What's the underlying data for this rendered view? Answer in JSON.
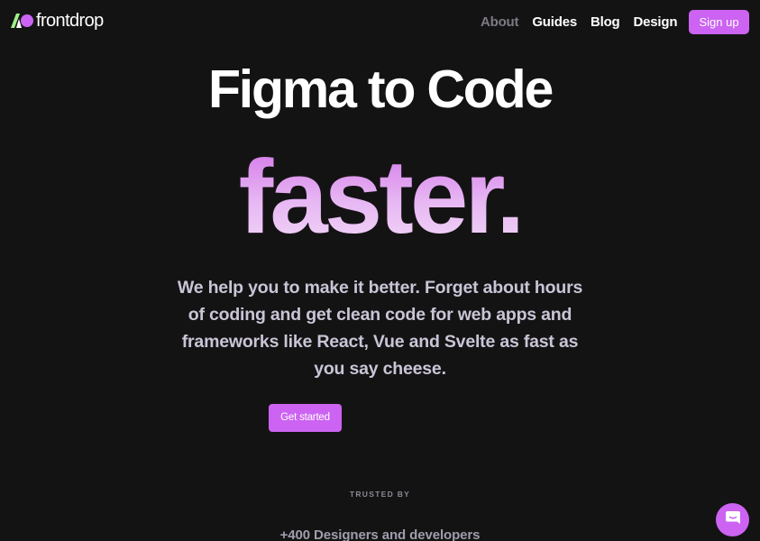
{
  "brand": {
    "name": "frontdrop",
    "accent_color": "#cc63f2",
    "logo_icon": "frontdrop-logo-icon"
  },
  "nav": {
    "items": [
      {
        "label": "About",
        "state": "active"
      },
      {
        "label": "Guides"
      },
      {
        "label": "Blog"
      },
      {
        "label": "Design"
      }
    ],
    "signup_label": "Sign up"
  },
  "hero": {
    "headline": "Figma to Code",
    "accent_word": "faster.",
    "description": "We help you to make it better. Forget about hours of coding and get clean code for web apps and frameworks like React, Vue and Svelte as fast as you say cheese.",
    "cta_label": "Get started"
  },
  "trust": {
    "label": "TRUSTED BY",
    "count_text": "+400 Designers and developers"
  },
  "chat": {
    "icon": "chat-bubble-icon"
  }
}
